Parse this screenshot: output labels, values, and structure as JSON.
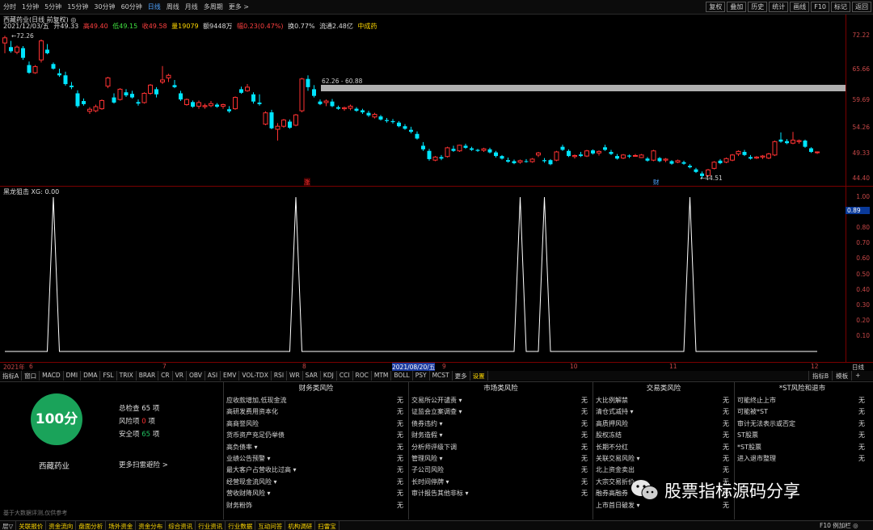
{
  "toolbar": {
    "periods": [
      "分时",
      "1分钟",
      "5分钟",
      "15分钟",
      "30分钟",
      "60分钟",
      "日线",
      "周线",
      "月线",
      "多周期",
      "更多 >"
    ],
    "active_period": "日线",
    "right_buttons": [
      "复权",
      "叠加",
      "历史",
      "统计",
      "画线",
      "F10",
      "标记",
      "返回"
    ]
  },
  "stock": {
    "title": "西藏药业(日线 前复权) ◎",
    "info": {
      "date": "2021/12/03/五",
      "open": "开49.33",
      "high": "高49.40",
      "low": "低49.15",
      "close": "收49.58",
      "volume": "量19079",
      "amount": "额9448万",
      "change": "幅0.23(0.47%)",
      "turnover": "换0.77%",
      "float": "流通2.48亿",
      "industry": "中成药"
    }
  },
  "price_axis": [
    "72.22",
    "65.66",
    "59.69",
    "54.26",
    "49.33",
    "44.40"
  ],
  "price_annotations": {
    "high_marker": "72.26",
    "low_marker": "44.51",
    "range_label": "62.26 - 60.88",
    "zhang_marker": "涨",
    "cai_marker": "财"
  },
  "indicator": {
    "title": "黑龙狙击 XG: 0.00",
    "current_value": "0.89",
    "axis": [
      "1.00",
      "0.90",
      "0.80",
      "0.70",
      "0.60",
      "0.50",
      "0.40",
      "0.30",
      "0.20",
      "0.10"
    ]
  },
  "date_axis": {
    "labels": [
      "2021年",
      "6",
      "7",
      "8",
      "9",
      "10",
      "11",
      "12"
    ],
    "cursor_date": "2021/08/20/五",
    "right_label": "日线"
  },
  "indicator_tabs": [
    "指标A",
    "窗口",
    "MACD",
    "DMI",
    "DMA",
    "FSL",
    "TRIX",
    "BRAR",
    "CR",
    "VR",
    "OBV",
    "ASI",
    "EMV",
    "VOL-TDX",
    "RSI",
    "WR",
    "SAR",
    "KDJ",
    "CCI",
    "ROC",
    "MTM",
    "BOLL",
    "PSY",
    "MCST",
    "更多",
    "设置"
  ],
  "indicator_tabs_right": [
    "指标B",
    "模板",
    "+"
  ],
  "risk": {
    "score": "100分",
    "stock_name": "西藏药业",
    "total_label": "总检查",
    "total_value": "65",
    "total_unit": "项",
    "risk_label": "风险项",
    "risk_value": "0",
    "risk_unit": "项",
    "safe_label": "安全项",
    "safe_value": "65",
    "safe_unit": "项",
    "more_label": "更多扫雷避险 >",
    "disclaimer": "基于大数据评测,仅供参考",
    "columns": [
      {
        "title": "财务类风险",
        "rows": [
          {
            "label": "应收款增加,低现金流",
            "status": "无"
          },
          {
            "label": "高研发费用资本化",
            "status": "无"
          },
          {
            "label": "高商誉风险",
            "status": "无"
          },
          {
            "label": "货币资产充足仍举债",
            "status": "无"
          },
          {
            "label": "高负债率 ▾",
            "status": "无"
          },
          {
            "label": "业绩公告预警 ▾",
            "status": "无"
          },
          {
            "label": "最大客户占营收比过高 ▾",
            "status": "无"
          },
          {
            "label": "经营现金流风险 ▾",
            "status": "无"
          },
          {
            "label": "营收财降风险 ▾",
            "status": "无"
          },
          {
            "label": "财务粉饰",
            "status": "无"
          }
        ]
      },
      {
        "title": "市场类风险",
        "rows": [
          {
            "label": "交易所公开谴责 ▾",
            "status": "无"
          },
          {
            "label": "证监会立案调查 ▾",
            "status": "无"
          },
          {
            "label": "债券违约 ▾",
            "status": "无"
          },
          {
            "label": "财务造假 ▾",
            "status": "无"
          },
          {
            "label": "分析师评级下调",
            "status": "无"
          },
          {
            "label": "管理风险 ▾",
            "status": "无"
          },
          {
            "label": "子公司风险",
            "status": "无"
          },
          {
            "label": "长时间停牌 ▾",
            "status": "无"
          },
          {
            "label": "审计报告其他非标 ▾",
            "status": "无"
          }
        ]
      },
      {
        "title": "交易类风险",
        "rows": [
          {
            "label": "大比例解禁",
            "status": "无"
          },
          {
            "label": "清仓式减持 ▾",
            "status": "无"
          },
          {
            "label": "高质押风险",
            "status": "无"
          },
          {
            "label": "股权冻结",
            "status": "无"
          },
          {
            "label": "长期不分红",
            "status": "无"
          },
          {
            "label": "关联交易风险 ▾",
            "status": "无"
          },
          {
            "label": "北上资金卖出",
            "status": "无"
          },
          {
            "label": "大宗交易折价",
            "status": "无"
          },
          {
            "label": "融券高融券",
            "status": "无"
          },
          {
            "label": "上市首日破发 ▾",
            "status": "无"
          }
        ]
      },
      {
        "title": "*ST风险和退市",
        "rows": [
          {
            "label": "可能终止上市",
            "status": "无"
          },
          {
            "label": "可能被*ST",
            "status": "无"
          },
          {
            "label": "审计无法表示或否定",
            "status": "无"
          },
          {
            "label": "ST股票",
            "status": "无"
          },
          {
            "label": "*ST股票",
            "status": "无"
          },
          {
            "label": "进入退市整理",
            "status": "无"
          }
        ]
      }
    ]
  },
  "watermark": "股票指标源码分享",
  "bottom_tabs": [
    "层▽",
    "关联报价",
    "资金流向",
    "盘面分析",
    "场外资金",
    "资金分布",
    "综合资讯",
    "行业资讯",
    "行业数据",
    "互动问答",
    "机构调研",
    "扫雷宝"
  ],
  "bottom_right": "F10 例加栏 ◎",
  "colors": {
    "up": "#ff3232",
    "down": "#00e5ff",
    "axis": "#c84848",
    "indicator_line": "#ffffff",
    "score_circle": "#1aa35a",
    "highlight": "#ffd800"
  },
  "chart_data": {
    "type": "candlestick",
    "ylim": [
      43.0,
      73.5
    ],
    "candles": [
      [
        70.8,
        72.2,
        68.8,
        71.8
      ],
      [
        70.0,
        71.2,
        68.9,
        69.2
      ],
      [
        69.0,
        70.3,
        68.6,
        70.0
      ],
      [
        69.8,
        70.2,
        67.5,
        67.9
      ],
      [
        66.5,
        67.2,
        64.8,
        65.0
      ],
      [
        65.0,
        66.5,
        64.8,
        66.2
      ],
      [
        67.5,
        71.5,
        67.0,
        71.2
      ],
      [
        69.5,
        70.6,
        68.6,
        68.8
      ],
      [
        66.7,
        67.0,
        65.6,
        65.8
      ],
      [
        64.9,
        65.8,
        64.2,
        64.5
      ],
      [
        64.5,
        65.2,
        62.5,
        62.8
      ],
      [
        62.5,
        63.2,
        61.8,
        62.2
      ],
      [
        61.0,
        61.6,
        58.2,
        58.5
      ],
      [
        59.5,
        60.0,
        58.6,
        58.9
      ],
      [
        57.5,
        58.3,
        57.0,
        57.9
      ],
      [
        57.6,
        58.8,
        57.3,
        58.4
      ],
      [
        58.0,
        59.8,
        57.8,
        59.6
      ],
      [
        62.4,
        64.2,
        62.0,
        64.0
      ],
      [
        60.2,
        61.0,
        59.0,
        59.2
      ],
      [
        59.8,
        62.0,
        59.6,
        61.8
      ],
      [
        61.2,
        61.8,
        60.3,
        60.6
      ],
      [
        60.9,
        61.5,
        60.0,
        60.2
      ],
      [
        59.3,
        59.8,
        58.6,
        59.0
      ],
      [
        59.2,
        61.2,
        59.0,
        61.0
      ],
      [
        61.0,
        62.8,
        60.7,
        62.6
      ],
      [
        61.8,
        62.2,
        60.2,
        60.8
      ],
      [
        63.2,
        66.3,
        62.8,
        63.6
      ],
      [
        64.0,
        64.8,
        63.2,
        64.5
      ],
      [
        62.6,
        63.6,
        62.0,
        62.2
      ],
      [
        61.0,
        61.5,
        59.5,
        59.8
      ],
      [
        58.8,
        60.0,
        58.6,
        59.8
      ],
      [
        59.3,
        59.6,
        58.2,
        58.4
      ],
      [
        58.5,
        59.6,
        58.0,
        59.2
      ],
      [
        58.4,
        59.0,
        58.0,
        58.6
      ],
      [
        58.6,
        59.5,
        58.3,
        59.0
      ],
      [
        58.8,
        59.1,
        58.2,
        58.4
      ],
      [
        58.5,
        59.0,
        58.0,
        58.8
      ],
      [
        57.9,
        58.5,
        57.2,
        57.5
      ],
      [
        58.0,
        60.4,
        57.8,
        60.2
      ],
      [
        61.8,
        62.3,
        60.9,
        61.1
      ],
      [
        61.5,
        62.8,
        61.3,
        62.2
      ],
      [
        60.8,
        61.2,
        59.0,
        59.4
      ],
      [
        59.2,
        60.8,
        58.6,
        58.9
      ],
      [
        55.0,
        57.5,
        54.8,
        57.2
      ],
      [
        57.3,
        57.8,
        54.0,
        54.2
      ],
      [
        54.0,
        55.2,
        51.8,
        54.6
      ],
      [
        54.6,
        56.0,
        54.3,
        55.8
      ],
      [
        55.5,
        55.9,
        54.1,
        54.3
      ],
      [
        54.8,
        57.0,
        54.6,
        56.8
      ],
      [
        57.6,
        64.0,
        57.3,
        63.8
      ],
      [
        63.8,
        64.5,
        61.5,
        62.2
      ],
      [
        61.8,
        62.6,
        60.2,
        60.5
      ],
      [
        59.4,
        59.8,
        58.7,
        58.9
      ],
      [
        59.2,
        59.8,
        58.5,
        59.5
      ],
      [
        59.4,
        59.9,
        58.3,
        58.5
      ],
      [
        58.3,
        58.6,
        57.8,
        58.0
      ],
      [
        58.0,
        58.4,
        57.6,
        58.2
      ],
      [
        58.1,
        58.8,
        57.7,
        58.5
      ],
      [
        58.0,
        58.3,
        57.4,
        57.6
      ],
      [
        57.7,
        58.0,
        57.0,
        57.3
      ],
      [
        57.2,
        57.6,
        56.4,
        56.7
      ],
      [
        56.4,
        57.2,
        56.1,
        56.9
      ],
      [
        56.5,
        56.8,
        55.7,
        55.9
      ],
      [
        55.8,
        56.2,
        55.3,
        55.6
      ],
      [
        55.6,
        56.0,
        55.1,
        55.4
      ],
      [
        55.3,
        55.6,
        54.4,
        54.6
      ],
      [
        54.6,
        55.0,
        53.9,
        54.1
      ],
      [
        53.9,
        54.5,
        53.2,
        53.5
      ],
      [
        53.1,
        53.6,
        52.0,
        52.2
      ],
      [
        50.8,
        51.5,
        49.8,
        50.1
      ],
      [
        49.8,
        50.2,
        47.9,
        48.2
      ],
      [
        48.0,
        48.8,
        47.8,
        48.6
      ],
      [
        48.6,
        49.0,
        48.0,
        48.3
      ],
      [
        48.7,
        50.6,
        48.5,
        50.4
      ],
      [
        50.2,
        50.8,
        49.6,
        49.8
      ],
      [
        49.8,
        51.0,
        49.6,
        50.9
      ],
      [
        50.8,
        51.2,
        50.2,
        50.4
      ],
      [
        50.3,
        50.6,
        49.8,
        50.0
      ],
      [
        50.0,
        50.2,
        49.6,
        49.8
      ],
      [
        49.9,
        50.4,
        49.6,
        50.2
      ],
      [
        50.1,
        50.4,
        49.3,
        49.5
      ],
      [
        49.5,
        49.8,
        48.5,
        48.8
      ],
      [
        48.8,
        49.0,
        48.1,
        48.3
      ],
      [
        48.0,
        48.5,
        47.5,
        47.7
      ],
      [
        47.8,
        48.1,
        47.2,
        47.4
      ],
      [
        47.6,
        48.1,
        47.3,
        47.9
      ],
      [
        47.8,
        48.2,
        47.5,
        47.7
      ],
      [
        47.7,
        48.4,
        47.5,
        48.2
      ],
      [
        49.0,
        49.6,
        48.6,
        49.4
      ],
      [
        48.0,
        48.4,
        47.5,
        47.8
      ],
      [
        48.0,
        48.2,
        47.0,
        47.2
      ],
      [
        48.0,
        49.8,
        47.8,
        49.6
      ],
      [
        50.6,
        51.0,
        49.8,
        50.0
      ],
      [
        49.8,
        50.1,
        48.6,
        48.8
      ],
      [
        48.7,
        49.1,
        48.3,
        48.9
      ],
      [
        49.1,
        49.6,
        48.6,
        48.8
      ],
      [
        48.8,
        50.0,
        48.6,
        49.8
      ],
      [
        49.9,
        50.1,
        49.1,
        49.3
      ],
      [
        49.4,
        49.9,
        48.9,
        49.7
      ],
      [
        50.5,
        51.0,
        49.8,
        50.0
      ],
      [
        49.6,
        50.0,
        49.0,
        49.2
      ],
      [
        48.8,
        49.2,
        48.1,
        48.3
      ],
      [
        48.4,
        49.2,
        48.2,
        49.0
      ],
      [
        48.9,
        49.1,
        48.4,
        48.7
      ],
      [
        48.9,
        49.2,
        48.7,
        48.9
      ],
      [
        48.5,
        49.2,
        48.4,
        49.0
      ],
      [
        48.3,
        48.6,
        47.7,
        47.9
      ],
      [
        48.0,
        50.0,
        47.8,
        49.8
      ],
      [
        48.4,
        48.6,
        47.6,
        47.8
      ],
      [
        48.0,
        48.4,
        47.6,
        48.2
      ],
      [
        47.8,
        48.0,
        47.1,
        47.3
      ],
      [
        47.6,
        48.1,
        47.4,
        47.9
      ],
      [
        47.6,
        47.9,
        47.1,
        47.3
      ],
      [
        46.9,
        47.2,
        46.4,
        46.6
      ],
      [
        46.2,
        46.5,
        45.5,
        45.7
      ],
      [
        45.4,
        45.8,
        44.5,
        44.9
      ],
      [
        45.0,
        46.3,
        44.8,
        46.1
      ],
      [
        46.4,
        47.8,
        46.2,
        47.6
      ],
      [
        47.9,
        48.2,
        47.2,
        47.4
      ],
      [
        47.6,
        48.5,
        47.4,
        48.3
      ],
      [
        48.0,
        49.2,
        47.8,
        49.0
      ],
      [
        49.2,
        49.9,
        48.8,
        49.7
      ],
      [
        49.6,
        50.0,
        48.8,
        49.0
      ],
      [
        48.6,
        49.0,
        48.1,
        48.3
      ],
      [
        48.4,
        48.8,
        48.2,
        48.6
      ],
      [
        48.6,
        49.0,
        48.2,
        48.8
      ],
      [
        48.4,
        49.4,
        48.2,
        49.2
      ],
      [
        49.0,
        51.8,
        48.8,
        51.6
      ],
      [
        52.0,
        53.4,
        51.4,
        51.6
      ],
      [
        51.7,
        52.1,
        51.1,
        51.3
      ],
      [
        51.3,
        53.5,
        51.1,
        51.9
      ],
      [
        51.6,
        52.0,
        51.2,
        51.8
      ],
      [
        51.8,
        52.0,
        50.4,
        50.6
      ],
      [
        50.3,
        50.5,
        49.4,
        49.6
      ],
      [
        49.5,
        49.7,
        49.2,
        49.6
      ]
    ],
    "indicator_xg_signals": [
      8,
      48,
      85,
      89,
      113
    ]
  }
}
